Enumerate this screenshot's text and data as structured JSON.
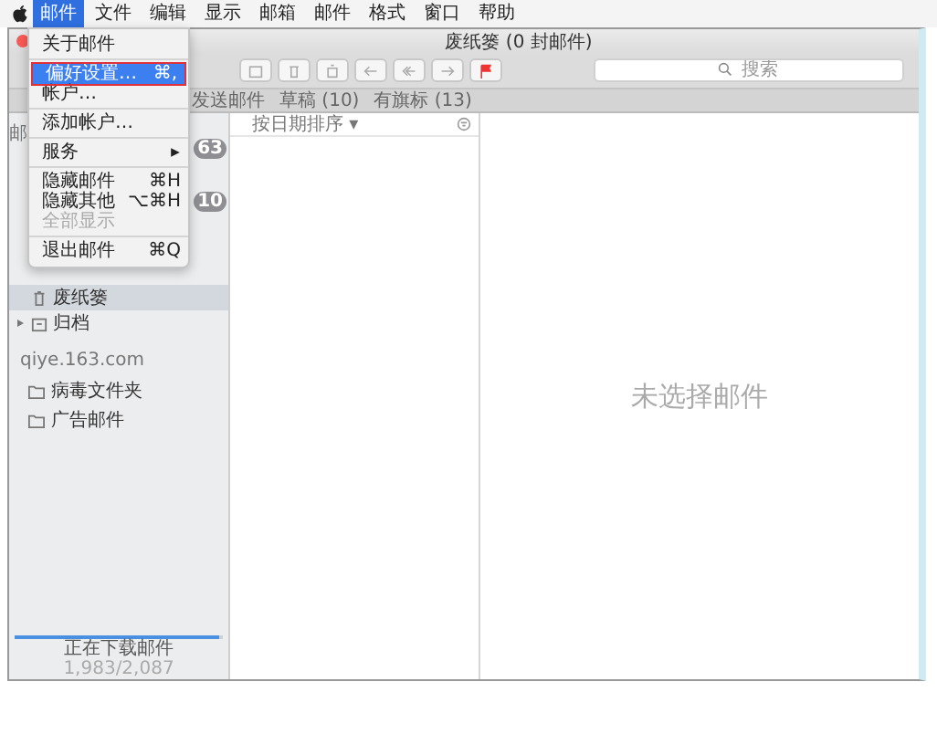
{
  "menubar": {
    "items": [
      {
        "label": "邮件",
        "selected": true
      },
      {
        "label": "文件",
        "selected": false
      },
      {
        "label": "编辑",
        "selected": false
      },
      {
        "label": "显示",
        "selected": false
      },
      {
        "label": "邮箱",
        "selected": false
      },
      {
        "label": "邮件",
        "selected": false
      },
      {
        "label": "格式",
        "selected": false
      },
      {
        "label": "窗口",
        "selected": false
      },
      {
        "label": "帮助",
        "selected": false
      }
    ]
  },
  "menu": {
    "items": [
      {
        "label": "关于邮件",
        "disabled": false,
        "selected": false,
        "separator_after": true
      },
      {
        "label": "偏好设置…",
        "shortcut": "⌘,",
        "disabled": false,
        "selected": true,
        "separator_after": false
      },
      {
        "label": "帐户…",
        "disabled": false,
        "selected": false,
        "separator_after": true
      },
      {
        "label": "添加帐户…",
        "disabled": false,
        "selected": false,
        "separator_after": true
      },
      {
        "label": "服务",
        "submenu": true,
        "disabled": false,
        "selected": false,
        "separator_after": true
      },
      {
        "label": "隐藏邮件",
        "shortcut": "⌘H",
        "disabled": false,
        "selected": false,
        "separator_after": false
      },
      {
        "label": "隐藏其他",
        "shortcut": "⌥⌘H",
        "disabled": false,
        "selected": false,
        "separator_after": false
      },
      {
        "label": "全部显示",
        "disabled": true,
        "selected": false,
        "separator_after": true
      },
      {
        "label": "退出邮件",
        "shortcut": "⌘Q",
        "disabled": false,
        "selected": false,
        "separator_after": false
      }
    ]
  },
  "window": {
    "title": "废纸篓 (0 封邮件)"
  },
  "search": {
    "placeholder": "搜索"
  },
  "favorites": [
    {
      "label": "发送邮件"
    },
    {
      "label": "草稿 (10)"
    },
    {
      "label": "有旗标 (13)"
    }
  ],
  "sidebar": {
    "heading": "邮",
    "badges": [
      "63",
      "10"
    ],
    "items": [
      {
        "label": "废纸篓",
        "kind": "trash",
        "selected": true,
        "expandable": false
      },
      {
        "label": "归档",
        "kind": "archive",
        "selected": false,
        "expandable": true
      }
    ],
    "account": "qiye.163.com",
    "account_items": [
      {
        "label": "病毒文件夹",
        "selected": false
      },
      {
        "label": "广告邮件",
        "selected": false
      }
    ],
    "activity": {
      "label": "正在下载邮件",
      "count": "1,983/2,087",
      "level": 0.98
    }
  },
  "message_list": {
    "sort": "按日期排序 ▾"
  },
  "preview": {
    "empty_text": "未选择邮件"
  }
}
